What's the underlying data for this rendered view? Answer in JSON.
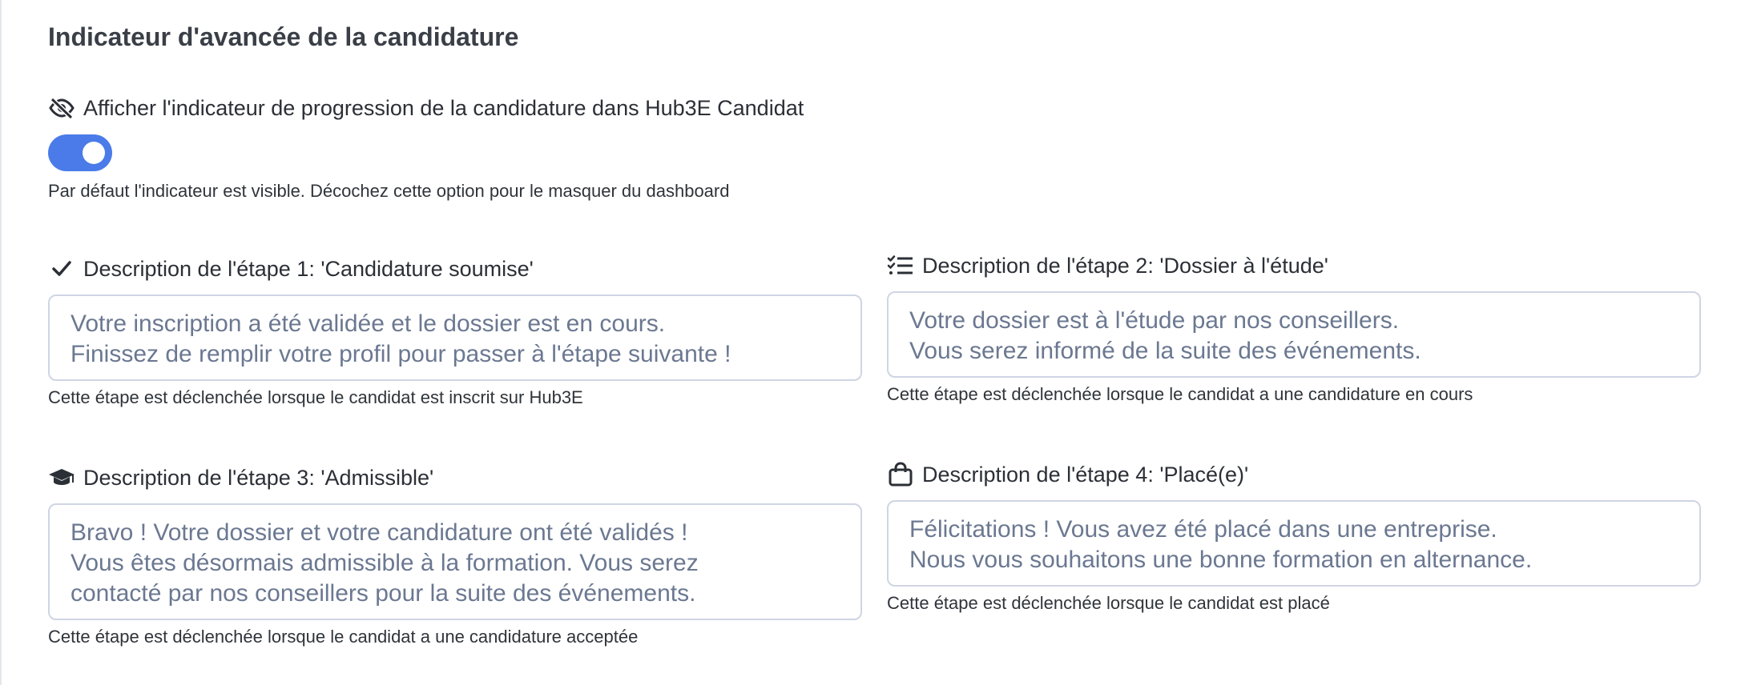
{
  "section": {
    "title": "Indicateur d'avancée de la candidature"
  },
  "visibility": {
    "label": "Afficher l'indicateur de progression de la candidature dans Hub3E Candidat",
    "enabled": true,
    "help": "Par défaut l'indicateur est visible. Décochez cette option pour le masquer du dashboard",
    "icon": "eye-slash-icon"
  },
  "steps": [
    {
      "icon": "check-icon",
      "label": "Description de l'étape 1: 'Candidature soumise'",
      "text": "Votre inscription a été validée et le dossier est en cours.\nFinissez de remplir votre profil pour passer à l'étape suivante !",
      "help": "Cette étape est déclenchée lorsque le candidat est inscrit sur Hub3E"
    },
    {
      "icon": "list-check-icon",
      "label": "Description de l'étape 2: 'Dossier à l'étude'",
      "text": "Votre dossier est à l'étude par nos conseillers.\nVous serez informé de la suite des événements.",
      "help": "Cette étape est déclenchée lorsque le candidat a une candidature en cours"
    },
    {
      "icon": "graduation-cap-icon",
      "label": "Description de l'étape 3: 'Admissible'",
      "text": "Bravo ! Votre dossier et votre candidature ont été validés !\nVous êtes désormais admissible à la formation. Vous serez\ncontacté par nos conseillers pour la suite des événements.",
      "help": "Cette étape est déclenchée lorsque le candidat a une candidature acceptée"
    },
    {
      "icon": "shopping-bag-icon",
      "label": "Description de l'étape 4: 'Placé(e)'",
      "text": "Félicitations ! Vous avez été placé dans une entreprise.\nNous vous souhaitons une bonne formation en alternance.",
      "help": "Cette étape est déclenchée lorsque le candidat est placé"
    }
  ],
  "colors": {
    "accent": "#4a7be8",
    "input_text": "#6b7891",
    "border": "#cfd5e3"
  }
}
